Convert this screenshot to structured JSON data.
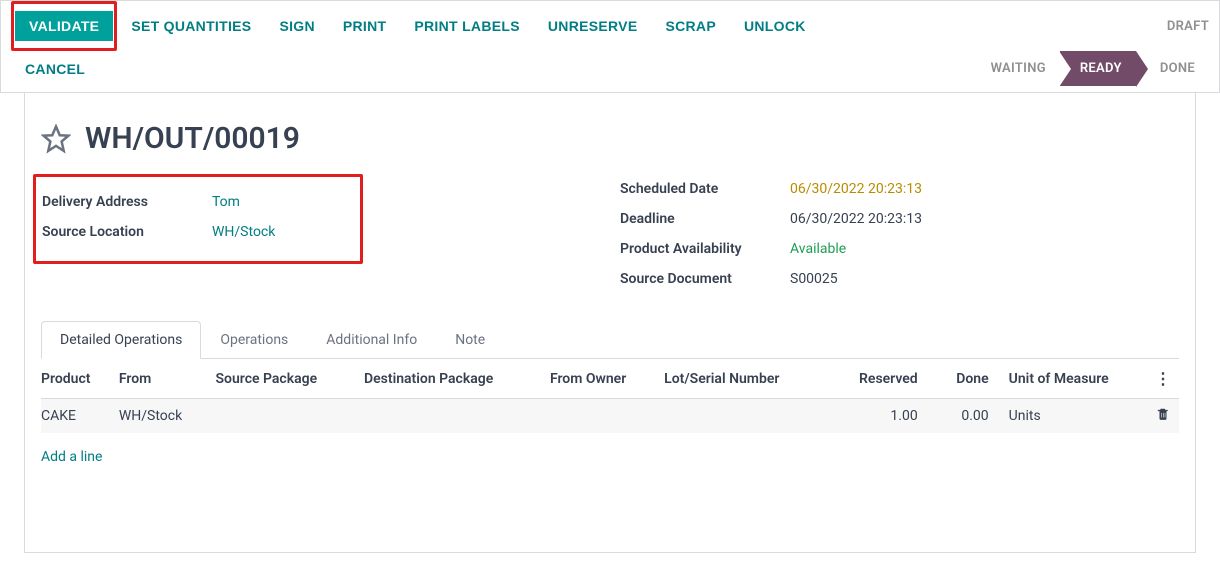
{
  "toolbar": {
    "validate": "VALIDATE",
    "set_quantities": "SET QUANTITIES",
    "sign": "SIGN",
    "print": "PRINT",
    "print_labels": "PRINT LABELS",
    "unreserve": "UNRESERVE",
    "scrap": "SCRAP",
    "unlock": "UNLOCK",
    "cancel": "CANCEL"
  },
  "status": {
    "draft": "DRAFT",
    "waiting": "WAITING",
    "ready": "READY",
    "done": "DONE"
  },
  "doc": {
    "title": "WH/OUT/00019",
    "delivery_address_label": "Delivery Address",
    "delivery_address_value": "Tom",
    "source_location_label": "Source Location",
    "source_location_value": "WH/Stock",
    "scheduled_date_label": "Scheduled Date",
    "scheduled_date_value": "06/30/2022 20:23:13",
    "deadline_label": "Deadline",
    "deadline_value": "06/30/2022 20:23:13",
    "product_availability_label": "Product Availability",
    "product_availability_value": "Available",
    "source_document_label": "Source Document",
    "source_document_value": "S00025"
  },
  "tabs": {
    "detailed": "Detailed Operations",
    "operations": "Operations",
    "additional": "Additional Info",
    "note": "Note"
  },
  "table": {
    "headers": {
      "product": "Product",
      "from": "From",
      "source_package": "Source Package",
      "destination_package": "Destination Package",
      "from_owner": "From Owner",
      "lot_serial": "Lot/Serial Number",
      "reserved": "Reserved",
      "done": "Done",
      "uom": "Unit of Measure"
    },
    "row": {
      "product": "CAKE",
      "from": "WH/Stock",
      "reserved": "1.00",
      "done": "0.00",
      "uom": "Units"
    },
    "add_line": "Add a line"
  }
}
